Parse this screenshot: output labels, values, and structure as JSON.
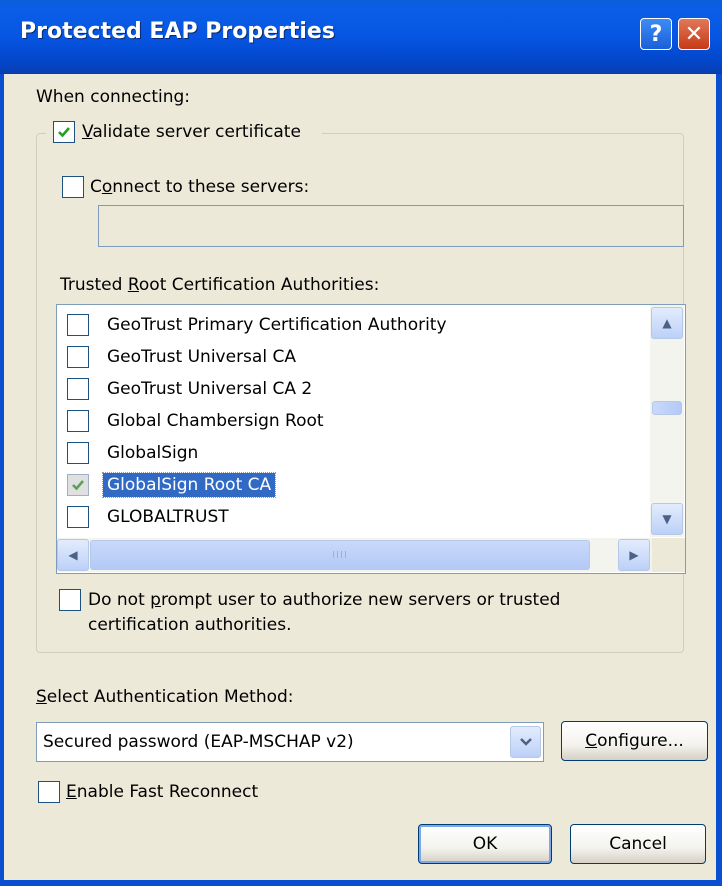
{
  "window": {
    "title": "Protected EAP Properties",
    "help_symbol": "?",
    "close_symbol": "✕"
  },
  "when_connecting_label": "When connecting:",
  "validate_cert": {
    "label_u": "V",
    "label_rest": "alidate server certificate",
    "checked": true
  },
  "connect_servers": {
    "label_pre": "C",
    "label_u": "o",
    "label_rest": "nnect to these servers:",
    "checked": false,
    "value": ""
  },
  "trusted_root": {
    "label_pre": "Trusted ",
    "label_u": "R",
    "label_rest": "oot Certification Authorities:"
  },
  "ca_list": [
    {
      "name": "GeoTrust Primary Certification Authority",
      "checked": false
    },
    {
      "name": "GeoTrust Universal CA",
      "checked": false
    },
    {
      "name": "GeoTrust Universal CA 2",
      "checked": false
    },
    {
      "name": "Global Chambersign Root",
      "checked": false
    },
    {
      "name": "GlobalSign",
      "checked": false
    },
    {
      "name": "GlobalSign Root CA",
      "checked": true,
      "selected": true
    },
    {
      "name": "GLOBALTRUST",
      "checked": false
    }
  ],
  "hscroll_grip": "IIII",
  "no_prompt": {
    "line1_pre": "Do not ",
    "line1_u": "p",
    "line1_rest": "rompt user to authorize new servers or trusted",
    "line2": "certification authorities.",
    "checked": false
  },
  "auth_method": {
    "label_u": "S",
    "label_rest": "elect Authentication Method:",
    "selected": "Secured password (EAP-MSCHAP v2)"
  },
  "configure_button": {
    "label_u": "C",
    "label_rest": "onfigure..."
  },
  "fast_reconnect": {
    "label_u": "E",
    "label_rest": "nable Fast Reconnect",
    "checked": false
  },
  "ok_button": "OK",
  "cancel_button": "Cancel",
  "colors": {
    "titlebar": "#0655e3",
    "dialog_bg": "#ece9d8",
    "selection": "#316ac5",
    "checkmark": "#21a121"
  }
}
